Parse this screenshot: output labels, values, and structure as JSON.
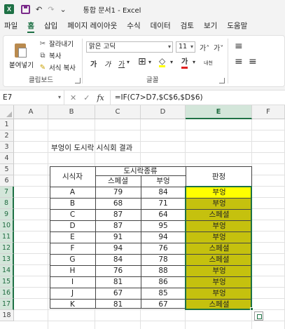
{
  "window": {
    "doc_title": "통합 문서1 - Excel",
    "app_letter": "X"
  },
  "qat": {
    "undo": "↶",
    "redo": "↷",
    "more": "⌄"
  },
  "menu": [
    "파일",
    "홈",
    "삽입",
    "페이지 레이아웃",
    "수식",
    "데이터",
    "검토",
    "보기",
    "도움말"
  ],
  "ribbon": {
    "paste_label": "붙여넣기",
    "cut_label": "잘라내기",
    "copy_label": "복사",
    "format_painter_label": "서식 복사",
    "clipboard_group": "클립보드",
    "font_name": "맑은 고딕",
    "font_size": "11",
    "font_group": "글꼴",
    "grow_font": "가˄",
    "shrink_font": "가˅",
    "bold": "가",
    "italic": "가",
    "underline": "가",
    "phonetic": "내천",
    "align_label": "≡"
  },
  "formula_bar": {
    "name_box": "E7",
    "cancel": "✕",
    "enter": "✓",
    "fx": "fx",
    "formula": "=IF(C7>D7,$C$6,$D$6)"
  },
  "columns": [
    "A",
    "B",
    "C",
    "D",
    "E",
    "F"
  ],
  "selected_column": "E",
  "rows": [
    "1",
    "2",
    "3",
    "4",
    "5",
    "6",
    "7",
    "8",
    "9",
    "10",
    "11",
    "12",
    "13",
    "14",
    "15",
    "16",
    "17",
    "18"
  ],
  "sheet": {
    "title": "부엉이 도시락 시식회 결과",
    "header_person": "시식자",
    "header_group": "도시락종류",
    "header_verdict": "판정",
    "header_type1": "스페셜",
    "header_type2": "부엉",
    "records": [
      {
        "name": "A",
        "special": "79",
        "bueong": "84",
        "verdict": "부엉"
      },
      {
        "name": "B",
        "special": "68",
        "bueong": "71",
        "verdict": "부엉"
      },
      {
        "name": "C",
        "special": "87",
        "bueong": "64",
        "verdict": "스페셜"
      },
      {
        "name": "D",
        "special": "87",
        "bueong": "95",
        "verdict": "부엉"
      },
      {
        "name": "E",
        "special": "91",
        "bueong": "94",
        "verdict": "부엉"
      },
      {
        "name": "F",
        "special": "94",
        "bueong": "76",
        "verdict": "스페셜"
      },
      {
        "name": "G",
        "special": "84",
        "bueong": "78",
        "verdict": "스페셜"
      },
      {
        "name": "H",
        "special": "76",
        "bueong": "88",
        "verdict": "부엉"
      },
      {
        "name": "I",
        "special": "81",
        "bueong": "86",
        "verdict": "부엉"
      },
      {
        "name": "J",
        "special": "67",
        "bueong": "85",
        "verdict": "부엉"
      },
      {
        "name": "K",
        "special": "81",
        "bueong": "67",
        "verdict": "스페셜"
      }
    ]
  },
  "colors": {
    "accent": "#1e7145",
    "verdict_fill": "#c5c10e",
    "active_fill": "#ffff00"
  }
}
